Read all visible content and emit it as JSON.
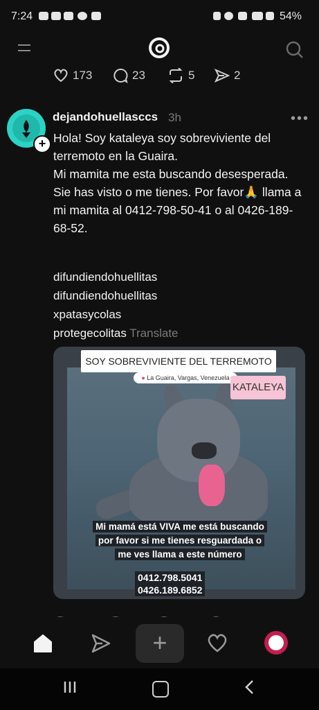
{
  "status_bar": {
    "time": "7:24",
    "battery": "54%"
  },
  "stats": {
    "likes": "173",
    "replies": "23",
    "reposts": "5",
    "shares": "2"
  },
  "post": {
    "username": "dejandohuellasccs",
    "time": "3h",
    "body_lines": [
      "Hola! Soy kataleya soy sobreviviente  del terremoto en la Guaira.",
      "Mi mamita me esta buscando desesperada.",
      "Sie has visto o me tienes. Por favor🙏 llama a mi mamita al 0412-798-50-41 o al 0426-189-68-52."
    ],
    "hashtags": [
      "difundiendohuellitas",
      "difundiendohuellitas",
      "xpatasycolas",
      "protegecolitas"
    ],
    "translate_label": "Translate",
    "image": {
      "banner": "SOY SOBREVIVIENTE DEL TERREMOTO",
      "location": "La Guaira, Vargas, Venezuela",
      "name": "KATALEYA",
      "caption_lines": [
        "Mi mamá está VIVA me está buscando",
        "por favor si me tienes resguardada o",
        "me ves llama a este número"
      ],
      "phone1": "0412.798.5041",
      "phone2": "0426.189.6852"
    }
  },
  "nav": {
    "create_symbol": "+"
  }
}
